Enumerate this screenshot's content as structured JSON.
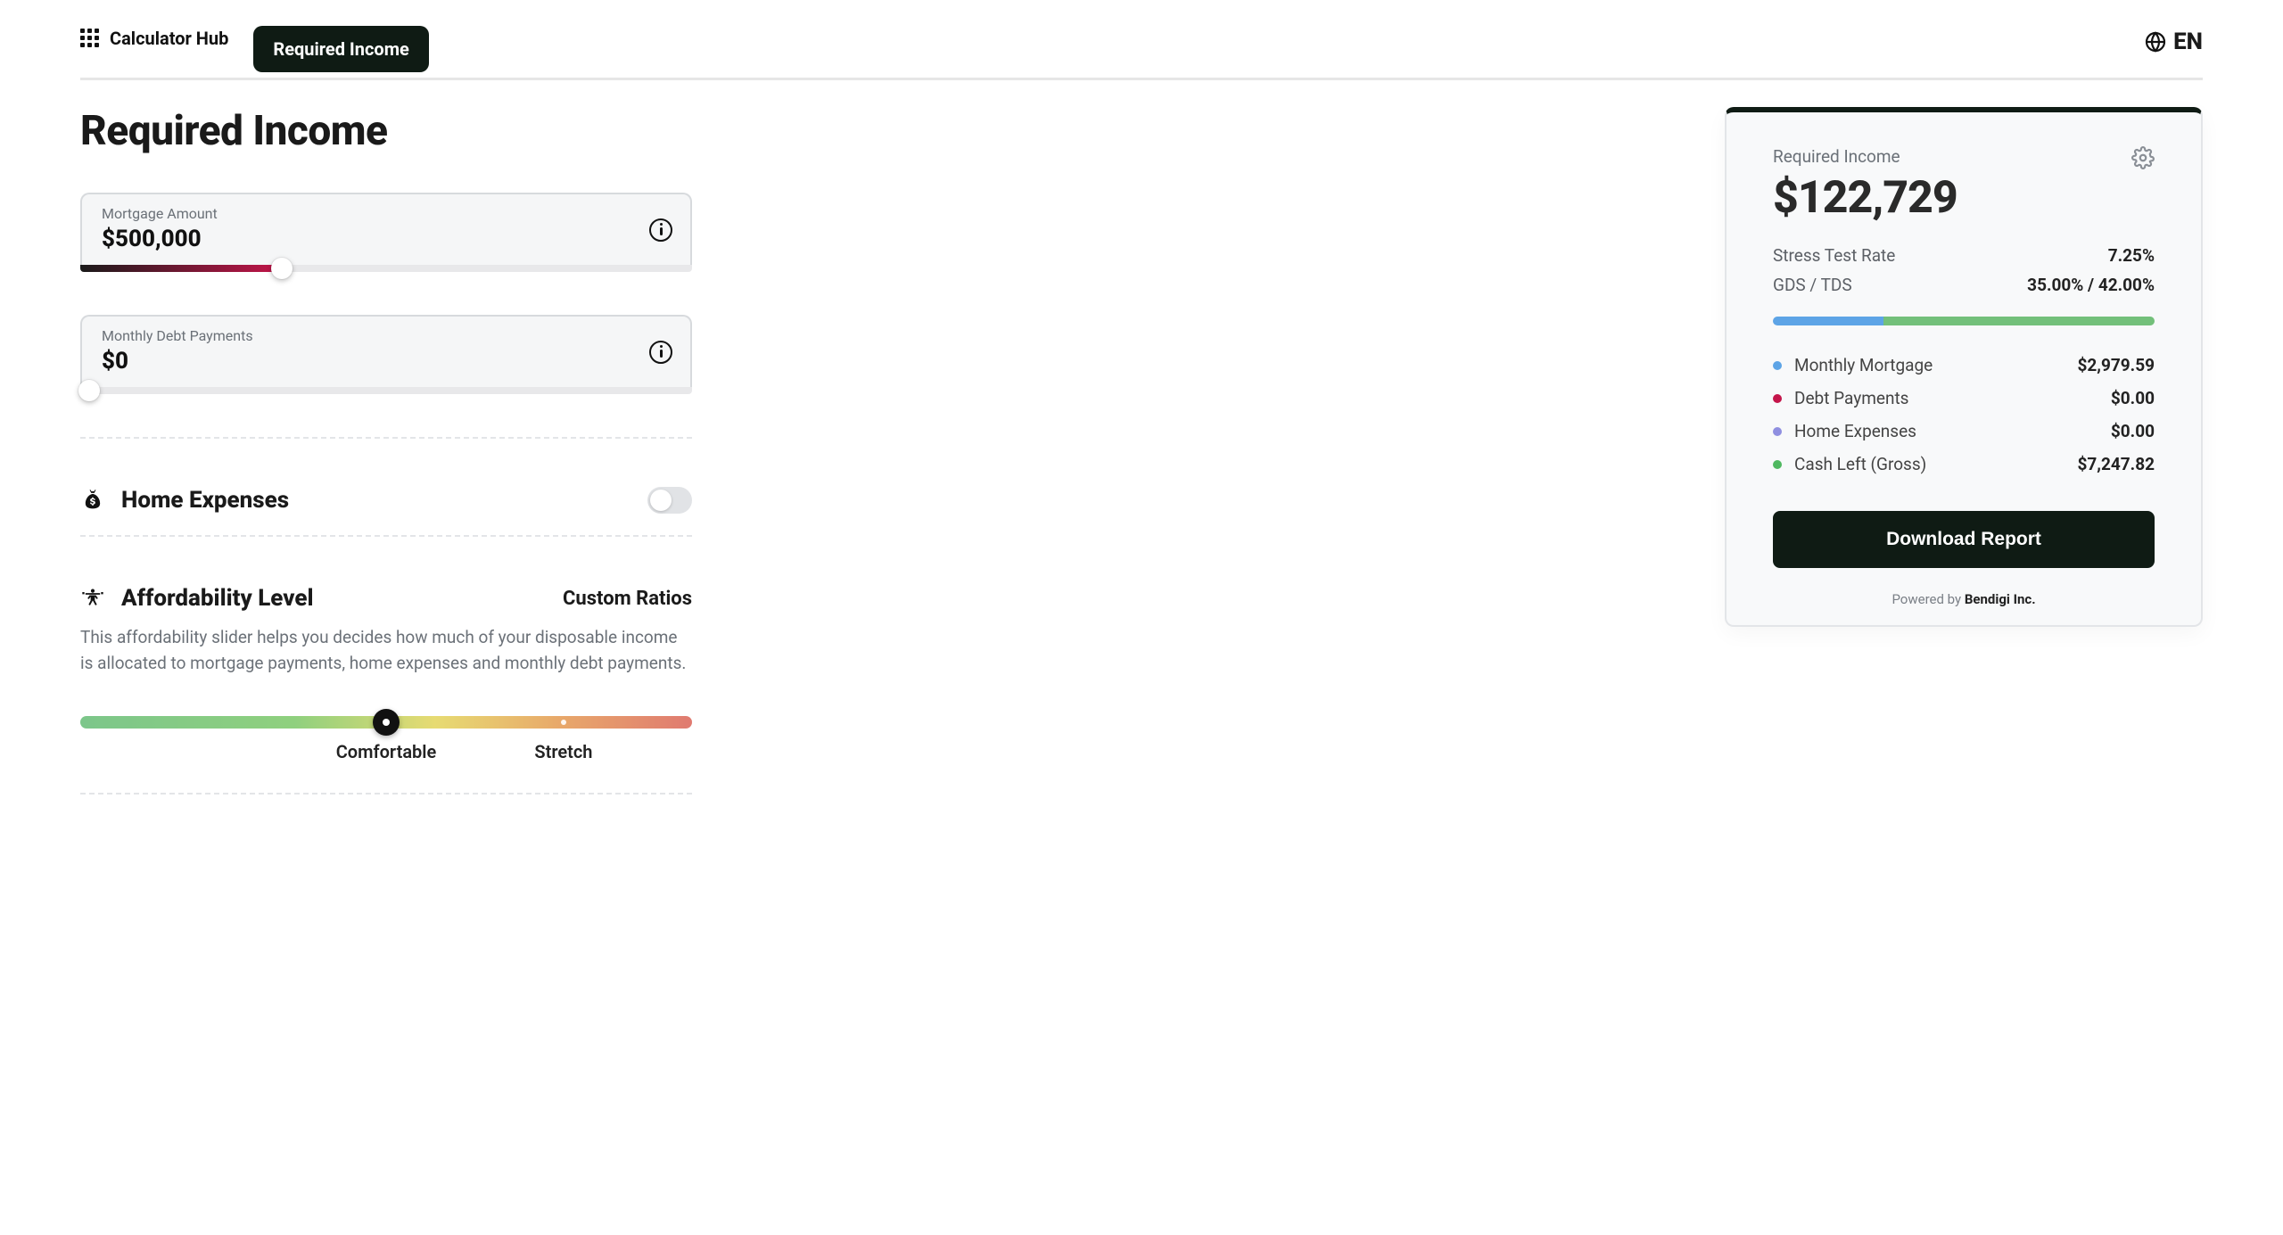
{
  "header": {
    "hub_label": "Calculator Hub",
    "active_tab": "Required Income",
    "language": "EN"
  },
  "page_title": "Required Income",
  "inputs": {
    "mortgage": {
      "label": "Mortgage Amount",
      "value": "$500,000",
      "slider_percent": 33
    },
    "debt": {
      "label": "Monthly Debt Payments",
      "value": "$0",
      "slider_percent": 1.5
    }
  },
  "home_expenses": {
    "title": "Home Expenses",
    "enabled": false
  },
  "affordability": {
    "title": "Affordability Level",
    "custom_link": "Custom Ratios",
    "description": "This affordability slider helps you decides how much of your disposable income is allocated to mortgage payments, home expenses and monthly debt payments.",
    "thumb_percent": 50,
    "stretch_dot_percent": 79,
    "label_comfortable": "Comfortable",
    "label_stretch": "Stretch"
  },
  "results": {
    "title": "Required Income",
    "value": "$122,729",
    "stress_label": "Stress Test Rate",
    "stress_value": "7.25%",
    "ratio_label": "GDS / TDS",
    "ratio_value": "35.00% / 42.00%",
    "breakdown": {
      "mortgage": {
        "name": "Monthly Mortgage",
        "amount": "$2,979.59"
      },
      "debt": {
        "name": "Debt Payments",
        "amount": "$0.00"
      },
      "home": {
        "name": "Home Expenses",
        "amount": "$0.00"
      },
      "cash": {
        "name": "Cash Left (Gross)",
        "amount": "$7,247.82"
      }
    },
    "download_label": "Download Report",
    "powered_prefix": "Powered by ",
    "powered_company": "Bendigi Inc."
  }
}
